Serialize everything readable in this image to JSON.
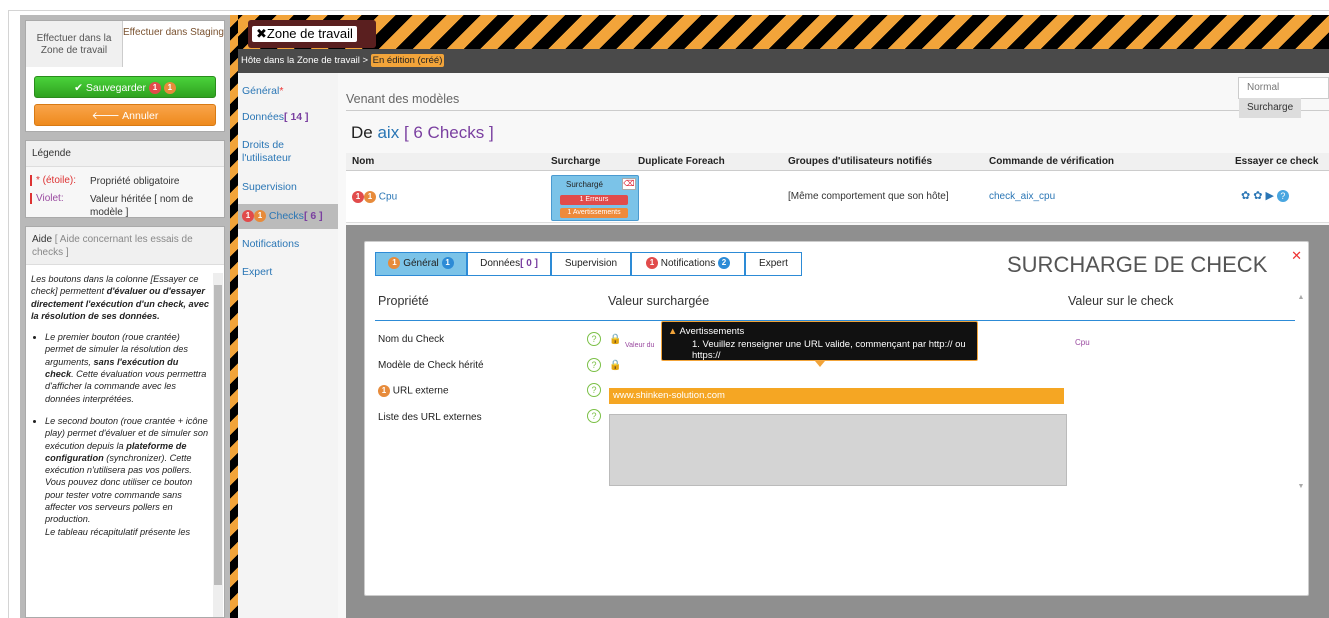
{
  "actions": {
    "tab_zone": "Effectuer dans la Zone de travail",
    "tab_staging": "Effectuer dans Staging",
    "save_label": "Sauvegarder",
    "save_badge_1": "1",
    "save_badge_2": "1",
    "cancel_label": "Annuler"
  },
  "legend": {
    "title": "Légende",
    "items": [
      {
        "key": "* (étoile):",
        "value": "Propriété obligatoire"
      },
      {
        "key": "Violet:",
        "value": "Valeur héritée [ nom de modèle ]"
      }
    ]
  },
  "help": {
    "title": "Aide",
    "subtitle": "[ Aide concernant les essais de checks ]",
    "intro_1": "Les boutons dans la colonne [Essayer ce check] permettent ",
    "intro_2": "d'évaluer ou d'essayer directement l'exécution d'un check, avec la résolution de ses données.",
    "bullet_1a": "Le premier bouton (roue crantée) permet de simuler la résolution des arguments, ",
    "bullet_1b": "sans l'exécution du check",
    "bullet_1c": ". Cette évaluation vous permettra d'afficher la commande avec les données interprétées.",
    "bullet_2a": "Le second bouton (roue crantée + icône play) permet d'évaluer et de simuler son exécution depuis la ",
    "bullet_2b": "plateforme de configuration",
    "bullet_2c": " (synchronizer). Cette exécution n'utilisera pas vos pollers. Vous pouvez donc utiliser ce bouton pour tester votre commande sans affecter vos serveurs pollers en production.",
    "bullet_2d": "Le tableau récapitulatif présente les"
  },
  "header": {
    "zone_title": "Zone de travail",
    "breadcrumb": "Hôte dans la Zone de travail > ",
    "state": "En édition (créé)"
  },
  "nav": {
    "general": "Général",
    "donnees": "Données",
    "donnees_count": "[ 14 ]",
    "droits": "Droits de l'utilisateur",
    "supervision": "Supervision",
    "checks": "Checks",
    "checks_count": "[ 6 ]",
    "notifications": "Notifications",
    "expert": "Expert"
  },
  "main": {
    "from_models": "Venant des modèles",
    "mode_normal": "Normal",
    "mode_surcharge": "Surcharge",
    "title_prefix": "De",
    "title_host": "aix",
    "title_count": "[ 6 Checks ]",
    "columns": [
      "Nom",
      "Surcharge",
      "Duplicate Foreach",
      "Groupes d'utilisateurs notifiés",
      "Commande de vérification",
      "Essayer ce check"
    ],
    "row": {
      "name": "Cpu",
      "surcharge_label": "Surchargé",
      "errors": "1 Erreurs",
      "warnings": "1 Avertissements",
      "groups": "[Même comportement que son hôte]",
      "command": "check_aix_cpu"
    }
  },
  "modal": {
    "title": "SURCHARGE DE CHECK",
    "tabs": {
      "general": "Général",
      "donnees": "Données",
      "donnees_count": "[ 0 ]",
      "supervision": "Supervision",
      "notifications": "Notifications",
      "expert": "Expert"
    },
    "headers": {
      "property": "Propriété",
      "value": "Valeur surchargée",
      "check_value": "Valeur sur le check"
    },
    "fields": {
      "check_name": "Nom du Check",
      "inherited_model": "Modèle de Check hérité",
      "url": "URL externe",
      "url_list": "Liste des URL externes"
    },
    "url_value": "www.shinken-solution.com",
    "inherited_hint": "Valeur du",
    "check_name_value": "Cpu",
    "tooltip_title": "Avertissements",
    "tooltip_msg": "1. Veuillez renseigner une URL valide, commençant par http:// ou https://"
  },
  "colors": {
    "hazard_orange": "#f2a43a",
    "save_green": "#2fa21f",
    "cancel_orange": "#ee8a1d",
    "link_blue": "#2a76b5",
    "inherited_violet": "#9a4aa0",
    "error_red": "#e14b4b"
  }
}
